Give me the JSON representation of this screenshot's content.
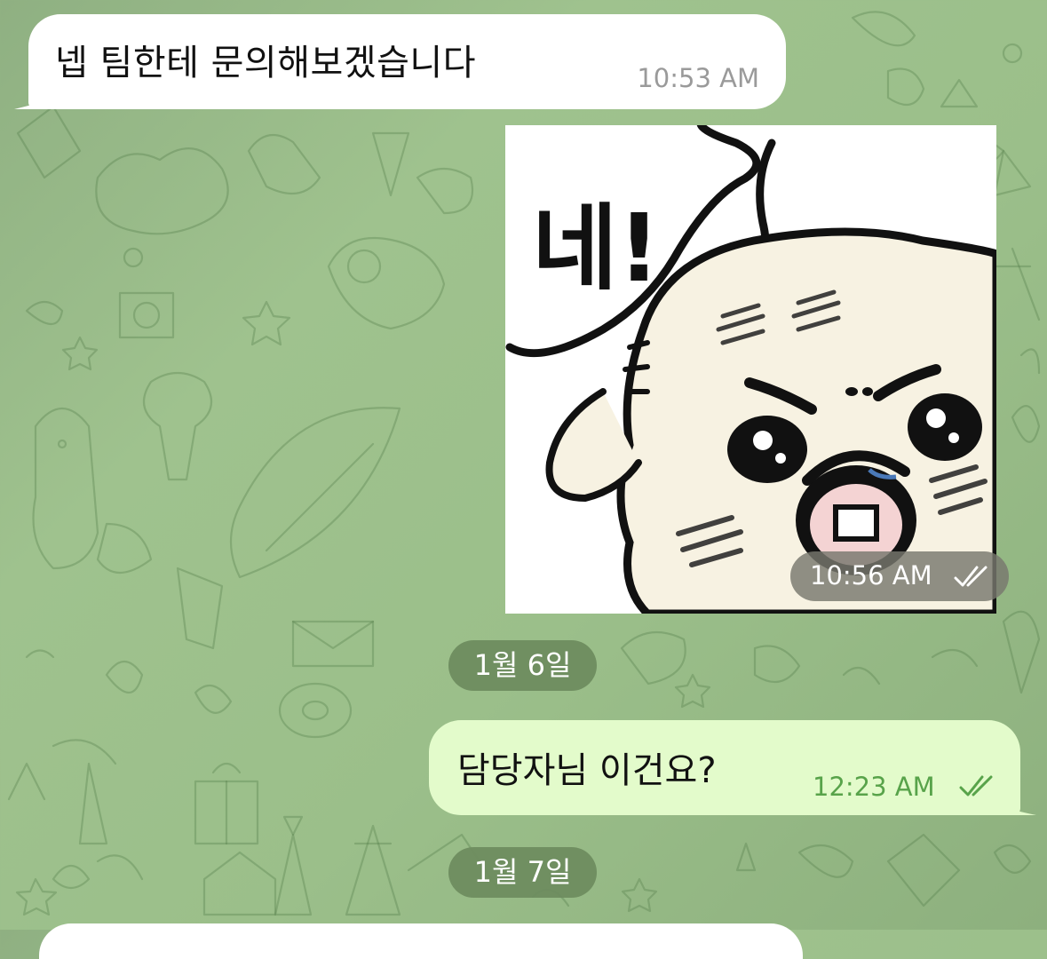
{
  "chat": {
    "messages": [
      {
        "direction": "incoming",
        "text": "넵 팀한테 문의해보겠습니다",
        "time": "10:53 AM"
      },
      {
        "direction": "outgoing",
        "type": "sticker",
        "sticker_text": "네!",
        "time": "10:56 AM",
        "status": "read-double-check-icon"
      },
      {
        "direction": "outgoing",
        "text": "담당자님 이건요?",
        "time": "12:23 AM",
        "status": "read-double-check-icon"
      }
    ],
    "date_separators": [
      "1월 6일",
      "1월 7일"
    ]
  },
  "colors": {
    "background": "#9bbf8a",
    "incoming_bubble": "#ffffff",
    "outgoing_bubble": "#e3fbcb",
    "outgoing_time": "#58a34a",
    "date_pill": "#6e8c5f"
  }
}
